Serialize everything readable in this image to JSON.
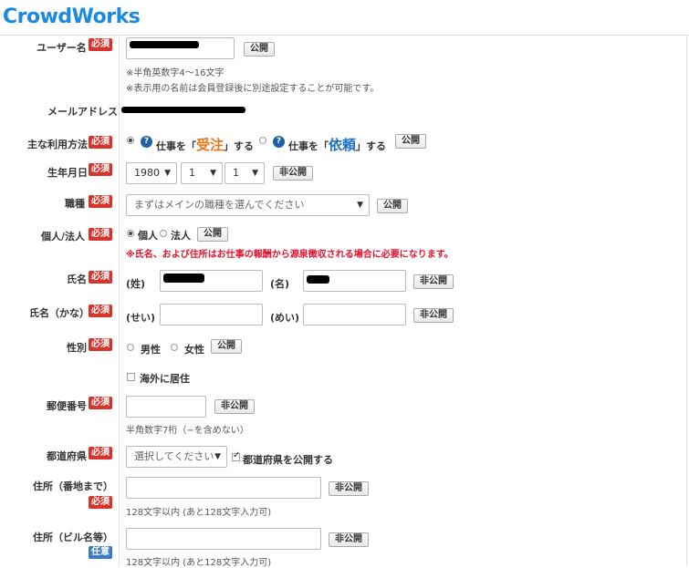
{
  "brand": {
    "logo": "CrowdWorks"
  },
  "badges": {
    "required": "必須",
    "optional": "任意"
  },
  "buttons": {
    "public": "公開",
    "private": "非公開"
  },
  "username": {
    "label": "ユーザー名",
    "note1": "※半角英数字4〜16文字",
    "note2": "※表示用の名前は会員登録後に別途設定することが可能です。"
  },
  "email": {
    "label": "メールアドレス"
  },
  "usage": {
    "label": "主な利用方法",
    "opt1_pre": "仕事を「",
    "opt1_em": "受注",
    "opt1_post": "」する",
    "opt2_pre": "仕事を「",
    "opt2_em": "依頼",
    "opt2_post": "」する",
    "help": "?"
  },
  "birthday": {
    "label": "生年月日",
    "year": "1980",
    "month": "1",
    "day": "1"
  },
  "occupation": {
    "label": "職種",
    "placeholder": "まずはメインの職種を選んでください"
  },
  "entity": {
    "label": "個人/法人",
    "opt1": "個人",
    "opt2": "法人",
    "warning": "※氏名、および住所はお仕事の報酬から源泉徴収される場合に必要になります。"
  },
  "name": {
    "label": "氏名",
    "sei": "(姓)",
    "mei": "(名)"
  },
  "kana": {
    "label": "氏名（かな）",
    "sei": "(せい)",
    "mei": "(めい)"
  },
  "gender": {
    "label": "性別",
    "male": "男性",
    "female": "女性"
  },
  "overseas": {
    "label": "海外に居住"
  },
  "zip": {
    "label": "郵便番号",
    "note": "半角数字7桁（−を含めない）"
  },
  "pref": {
    "label": "都道府県",
    "placeholder": "選択してください",
    "publish": "都道府県を公開する"
  },
  "addr1": {
    "label": "住所（番地まで）",
    "note": "128文字以内 (あと128文字入力可)"
  },
  "addr2": {
    "label": "住所（ビル名等）",
    "note": "128文字以内 (あと128文字入力可)"
  }
}
